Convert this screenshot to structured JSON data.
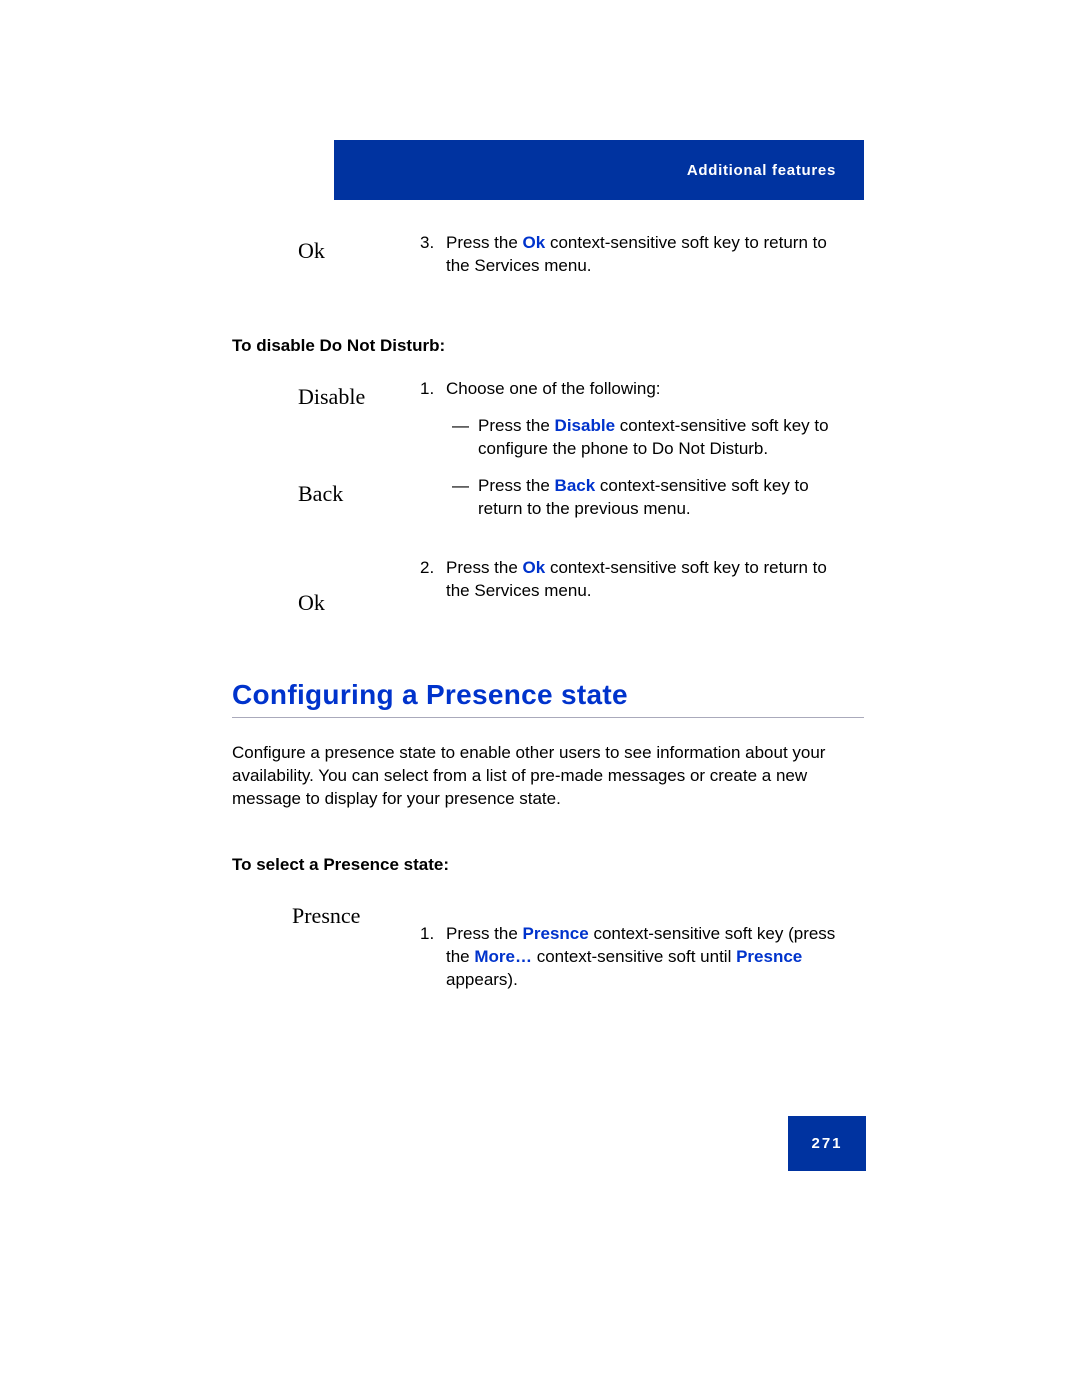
{
  "header": "Additional features",
  "page_number": "271",
  "step3": {
    "key": "Ok",
    "num": "3.",
    "t1": "Press the ",
    "k": "Ok",
    "t2": " context-sensitive soft key to return to the Services menu."
  },
  "subhead_disable": "To disable Do Not Disturb:",
  "disable_keys": {
    "k1": "Disable",
    "k2": "Back",
    "k3": "Ok"
  },
  "step1": {
    "num": "1.",
    "lead": "Choose one of the following:",
    "opt_a": {
      "t1": "Press the ",
      "k": "Disable",
      "t2": " context-sensitive soft key to configure the phone to Do Not Disturb."
    },
    "opt_b": {
      "t1": "Press the ",
      "k": "Back",
      "t2": " context-sensitive soft key to return to the previous menu."
    }
  },
  "step2": {
    "num": "2.",
    "t1": "Press the ",
    "k": "Ok",
    "t2": " context-sensitive soft key to return to the Services menu."
  },
  "section_title": "Configuring a Presence state",
  "section_para": "Configure a presence state to enable other users to see information about your availability. You can select from a list of pre-made messages or create a new message to display for your presence state.",
  "subhead_select": "To select a Presence state:",
  "presnce_key": "Presnce",
  "presnce_step": {
    "num": "1.",
    "t1": "Press the ",
    "k1": "Presnce",
    "t2": " context-sensitive soft key (press the ",
    "k2": "More…",
    "t3": " context-sensitive soft until ",
    "k3": "Presnce",
    "t4": " appears)."
  }
}
